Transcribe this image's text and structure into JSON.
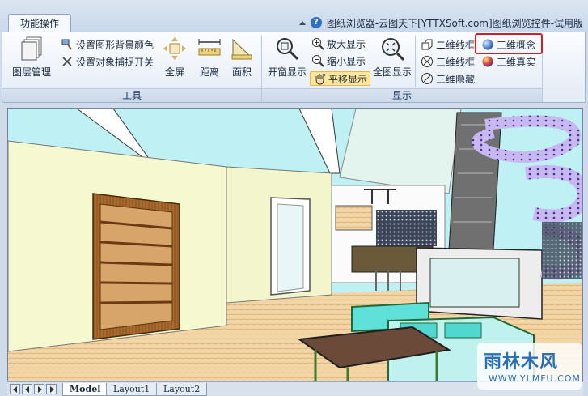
{
  "ribbon": {
    "tab": "功能操作",
    "window_title": "图纸浏览器-云图天下[YTTXSoft.com]图纸浏览控件-试用版",
    "groups": {
      "tools": {
        "label": "工具",
        "layers": "图层管理",
        "bg_color": "设置图形背景颜色",
        "snap": "设置对象捕捉开关",
        "fullscreen": "全屏",
        "distance": "距离",
        "area": "面积"
      },
      "display": {
        "label": "显示",
        "window_zoom": "开窗显示",
        "zoom_in": "放大显示",
        "zoom_out": "缩小显示",
        "pan": "平移显示",
        "zoom_all": "全图显示",
        "wireframe2d": "二维线框",
        "wireframe3d": "三维线框",
        "hidden3d": "三维隐藏",
        "concept3d": "三维概念",
        "realistic3d": "三维真实"
      }
    }
  },
  "layout_tabs": [
    "Model",
    "Layout1",
    "Layout2"
  ],
  "active_layout": "Model",
  "watermark": {
    "main": "雨林木风",
    "sub": "WWW.YLMFU.COM"
  },
  "colors": {
    "highlight_box": "#d21f1f",
    "pan_highlight": "#ffe79a",
    "accent": "#2f6fc4"
  }
}
